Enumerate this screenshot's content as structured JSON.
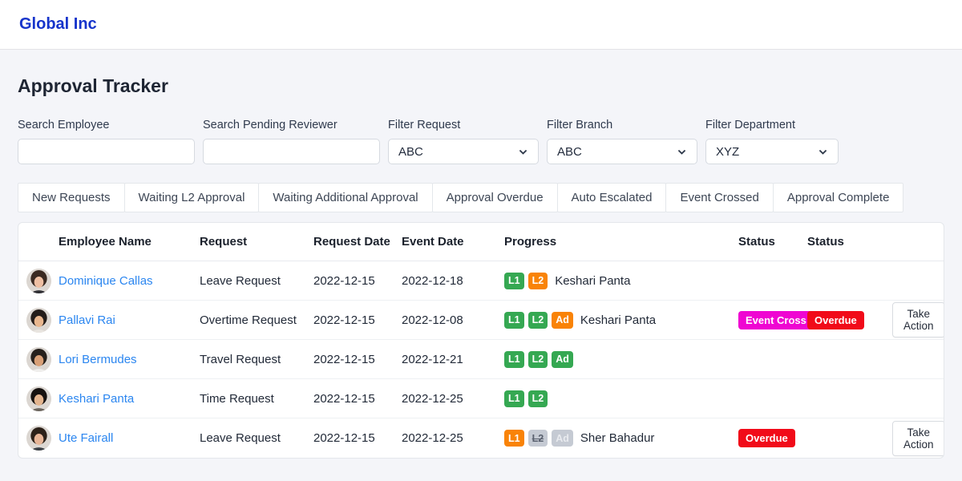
{
  "brand": {
    "name": "Global Inc"
  },
  "page": {
    "title": "Approval Tracker"
  },
  "colors": {
    "brand_blue": "#1634cb",
    "link_blue": "#2b86f0",
    "green": "#35a852",
    "orange": "#f98307",
    "gray": "#c5cad3",
    "magenta": "#ef06d2",
    "red": "#f10b19",
    "page_bg": "#f4f5f9"
  },
  "filters": [
    {
      "label": "Search Employee",
      "type": "text",
      "value": "",
      "placeholder": ""
    },
    {
      "label": "Search Pending Reviewer",
      "type": "text",
      "value": "",
      "placeholder": ""
    },
    {
      "label": "Filter Request",
      "type": "select",
      "value": "ABC"
    },
    {
      "label": "Filter Branch",
      "type": "select",
      "value": "ABC"
    },
    {
      "label": "Filter Department",
      "type": "select",
      "value": "XYZ"
    }
  ],
  "tabs": [
    {
      "label": "New Requests"
    },
    {
      "label": "Waiting L2 Approval"
    },
    {
      "label": "Waiting Additional Approval"
    },
    {
      "label": "Approval Overdue"
    },
    {
      "label": "Auto Escalated"
    },
    {
      "label": "Event Crossed"
    },
    {
      "label": "Approval Complete"
    }
  ],
  "table": {
    "headers": [
      "Employee Name",
      "Request",
      "Request Date",
      "Event Date",
      "Progress",
      "Status",
      "Status"
    ],
    "action_label": "Take Action",
    "rows": [
      {
        "employee": "Dominique Callas",
        "request": "Leave Request",
        "request_date": "2022-12-15",
        "event_date": "2022-12-18",
        "progress": [
          {
            "label": "L1",
            "state": "approved"
          },
          {
            "label": "L2",
            "state": "pending"
          }
        ],
        "reviewer": "Keshari Panta",
        "status1": null,
        "status2": null,
        "action": false,
        "avatar": {
          "hair": "#3a2a22",
          "skin": "#eebfa3",
          "shirt": "#2e2e33"
        }
      },
      {
        "employee": "Pallavi Rai",
        "request": "Overtime Request",
        "request_date": "2022-12-15",
        "event_date": "2022-12-08",
        "progress": [
          {
            "label": "L1",
            "state": "approved"
          },
          {
            "label": "L2",
            "state": "approved"
          },
          {
            "label": "Ad",
            "state": "pending"
          }
        ],
        "reviewer": "Keshari Panta",
        "status1": {
          "label": "Event Cross",
          "color": "magenta"
        },
        "status2": {
          "label": "Overdue",
          "color": "red"
        },
        "action": true,
        "avatar": {
          "hair": "#241d1a",
          "skin": "#e9b78f",
          "shirt": "#e9e5e0"
        }
      },
      {
        "employee": "Lori Bermudes",
        "request": "Travel Request",
        "request_date": "2022-12-15",
        "event_date": "2022-12-21",
        "progress": [
          {
            "label": "L1",
            "state": "approved"
          },
          {
            "label": "L2",
            "state": "approved"
          },
          {
            "label": "Ad",
            "state": "approved"
          }
        ],
        "reviewer": "",
        "status1": null,
        "status2": null,
        "action": false,
        "avatar": {
          "hair": "#26201c",
          "skin": "#d9a077",
          "shirt": "#f0efed"
        }
      },
      {
        "employee": "Keshari Panta",
        "request": "Time Request",
        "request_date": "2022-12-15",
        "event_date": "2022-12-25",
        "progress": [
          {
            "label": "L1",
            "state": "approved"
          },
          {
            "label": "L2",
            "state": "approved"
          }
        ],
        "reviewer": "",
        "status1": null,
        "status2": null,
        "action": false,
        "avatar": {
          "hair": "#171210",
          "skin": "#e4b58f",
          "shirt": "#6c665f"
        }
      },
      {
        "employee": "Ute Fairall",
        "request": "Leave Request",
        "request_date": "2022-12-15",
        "event_date": "2022-12-25",
        "progress": [
          {
            "label": "L1",
            "state": "pending"
          },
          {
            "label": "L2",
            "state": "skipped"
          },
          {
            "label": "Ad",
            "state": "disabled"
          }
        ],
        "reviewer": "Sher Bahadur",
        "status1": {
          "label": "Overdue",
          "color": "red"
        },
        "status2": null,
        "action": true,
        "avatar": {
          "hair": "#2c2119",
          "skin": "#e7b597",
          "shirt": "#3a3f45"
        }
      }
    ]
  }
}
